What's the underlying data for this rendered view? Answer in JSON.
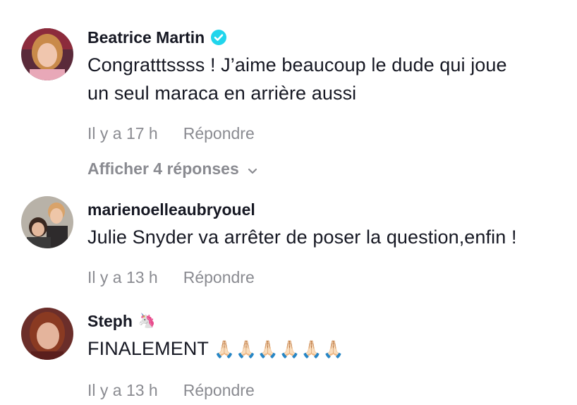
{
  "comments": [
    {
      "username": "Beatrice Martin",
      "verified": true,
      "text_line1": "Congratttssss ! J’aime beaucoup le dude qui joue",
      "text_line2": "un seul maraca en arrière aussi",
      "time": "Il y a 17 h",
      "reply_label": "Répondre",
      "view_replies_label": "Afficher 4 réponses"
    },
    {
      "username": "marienoelleaubryouel",
      "text": "Julie Snyder va arrêter de poser la question,enfin !",
      "time": "Il y a 13 h",
      "reply_label": "Répondre"
    },
    {
      "username": "Steph",
      "username_emoji": "🦄",
      "text": "FINALEMENT",
      "text_emoji": "🙏🏻🙏🏻🙏🏻🙏🏻🙏🏻🙏🏻",
      "time": "Il y a 13 h",
      "reply_label": "Répondre"
    }
  ],
  "colors": {
    "primary_text": "#161823",
    "secondary_text": "#8a8b91",
    "verified_badge": "#20d5ec",
    "background": "#ffffff"
  },
  "icons": {
    "verified": "verified-check-icon",
    "expand": "chevron-down-icon"
  }
}
